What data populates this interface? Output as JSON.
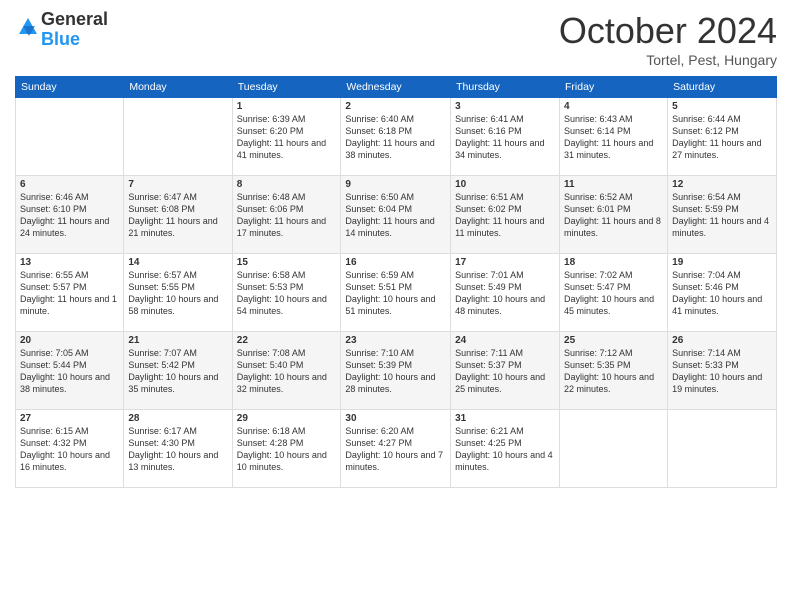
{
  "header": {
    "logo_general": "General",
    "logo_blue": "Blue",
    "month_title": "October 2024",
    "location": "Tortel, Pest, Hungary"
  },
  "weekdays": [
    "Sunday",
    "Monday",
    "Tuesday",
    "Wednesday",
    "Thursday",
    "Friday",
    "Saturday"
  ],
  "weeks": [
    [
      {
        "day": "",
        "sunrise": "",
        "sunset": "",
        "daylight": ""
      },
      {
        "day": "",
        "sunrise": "",
        "sunset": "",
        "daylight": ""
      },
      {
        "day": "1",
        "sunrise": "Sunrise: 6:39 AM",
        "sunset": "Sunset: 6:20 PM",
        "daylight": "Daylight: 11 hours and 41 minutes."
      },
      {
        "day": "2",
        "sunrise": "Sunrise: 6:40 AM",
        "sunset": "Sunset: 6:18 PM",
        "daylight": "Daylight: 11 hours and 38 minutes."
      },
      {
        "day": "3",
        "sunrise": "Sunrise: 6:41 AM",
        "sunset": "Sunset: 6:16 PM",
        "daylight": "Daylight: 11 hours and 34 minutes."
      },
      {
        "day": "4",
        "sunrise": "Sunrise: 6:43 AM",
        "sunset": "Sunset: 6:14 PM",
        "daylight": "Daylight: 11 hours and 31 minutes."
      },
      {
        "day": "5",
        "sunrise": "Sunrise: 6:44 AM",
        "sunset": "Sunset: 6:12 PM",
        "daylight": "Daylight: 11 hours and 27 minutes."
      }
    ],
    [
      {
        "day": "6",
        "sunrise": "Sunrise: 6:46 AM",
        "sunset": "Sunset: 6:10 PM",
        "daylight": "Daylight: 11 hours and 24 minutes."
      },
      {
        "day": "7",
        "sunrise": "Sunrise: 6:47 AM",
        "sunset": "Sunset: 6:08 PM",
        "daylight": "Daylight: 11 hours and 21 minutes."
      },
      {
        "day": "8",
        "sunrise": "Sunrise: 6:48 AM",
        "sunset": "Sunset: 6:06 PM",
        "daylight": "Daylight: 11 hours and 17 minutes."
      },
      {
        "day": "9",
        "sunrise": "Sunrise: 6:50 AM",
        "sunset": "Sunset: 6:04 PM",
        "daylight": "Daylight: 11 hours and 14 minutes."
      },
      {
        "day": "10",
        "sunrise": "Sunrise: 6:51 AM",
        "sunset": "Sunset: 6:02 PM",
        "daylight": "Daylight: 11 hours and 11 minutes."
      },
      {
        "day": "11",
        "sunrise": "Sunrise: 6:52 AM",
        "sunset": "Sunset: 6:01 PM",
        "daylight": "Daylight: 11 hours and 8 minutes."
      },
      {
        "day": "12",
        "sunrise": "Sunrise: 6:54 AM",
        "sunset": "Sunset: 5:59 PM",
        "daylight": "Daylight: 11 hours and 4 minutes."
      }
    ],
    [
      {
        "day": "13",
        "sunrise": "Sunrise: 6:55 AM",
        "sunset": "Sunset: 5:57 PM",
        "daylight": "Daylight: 11 hours and 1 minute."
      },
      {
        "day": "14",
        "sunrise": "Sunrise: 6:57 AM",
        "sunset": "Sunset: 5:55 PM",
        "daylight": "Daylight: 10 hours and 58 minutes."
      },
      {
        "day": "15",
        "sunrise": "Sunrise: 6:58 AM",
        "sunset": "Sunset: 5:53 PM",
        "daylight": "Daylight: 10 hours and 54 minutes."
      },
      {
        "day": "16",
        "sunrise": "Sunrise: 6:59 AM",
        "sunset": "Sunset: 5:51 PM",
        "daylight": "Daylight: 10 hours and 51 minutes."
      },
      {
        "day": "17",
        "sunrise": "Sunrise: 7:01 AM",
        "sunset": "Sunset: 5:49 PM",
        "daylight": "Daylight: 10 hours and 48 minutes."
      },
      {
        "day": "18",
        "sunrise": "Sunrise: 7:02 AM",
        "sunset": "Sunset: 5:47 PM",
        "daylight": "Daylight: 10 hours and 45 minutes."
      },
      {
        "day": "19",
        "sunrise": "Sunrise: 7:04 AM",
        "sunset": "Sunset: 5:46 PM",
        "daylight": "Daylight: 10 hours and 41 minutes."
      }
    ],
    [
      {
        "day": "20",
        "sunrise": "Sunrise: 7:05 AM",
        "sunset": "Sunset: 5:44 PM",
        "daylight": "Daylight: 10 hours and 38 minutes."
      },
      {
        "day": "21",
        "sunrise": "Sunrise: 7:07 AM",
        "sunset": "Sunset: 5:42 PM",
        "daylight": "Daylight: 10 hours and 35 minutes."
      },
      {
        "day": "22",
        "sunrise": "Sunrise: 7:08 AM",
        "sunset": "Sunset: 5:40 PM",
        "daylight": "Daylight: 10 hours and 32 minutes."
      },
      {
        "day": "23",
        "sunrise": "Sunrise: 7:10 AM",
        "sunset": "Sunset: 5:39 PM",
        "daylight": "Daylight: 10 hours and 28 minutes."
      },
      {
        "day": "24",
        "sunrise": "Sunrise: 7:11 AM",
        "sunset": "Sunset: 5:37 PM",
        "daylight": "Daylight: 10 hours and 25 minutes."
      },
      {
        "day": "25",
        "sunrise": "Sunrise: 7:12 AM",
        "sunset": "Sunset: 5:35 PM",
        "daylight": "Daylight: 10 hours and 22 minutes."
      },
      {
        "day": "26",
        "sunrise": "Sunrise: 7:14 AM",
        "sunset": "Sunset: 5:33 PM",
        "daylight": "Daylight: 10 hours and 19 minutes."
      }
    ],
    [
      {
        "day": "27",
        "sunrise": "Sunrise: 6:15 AM",
        "sunset": "Sunset: 4:32 PM",
        "daylight": "Daylight: 10 hours and 16 minutes."
      },
      {
        "day": "28",
        "sunrise": "Sunrise: 6:17 AM",
        "sunset": "Sunset: 4:30 PM",
        "daylight": "Daylight: 10 hours and 13 minutes."
      },
      {
        "day": "29",
        "sunrise": "Sunrise: 6:18 AM",
        "sunset": "Sunset: 4:28 PM",
        "daylight": "Daylight: 10 hours and 10 minutes."
      },
      {
        "day": "30",
        "sunrise": "Sunrise: 6:20 AM",
        "sunset": "Sunset: 4:27 PM",
        "daylight": "Daylight: 10 hours and 7 minutes."
      },
      {
        "day": "31",
        "sunrise": "Sunrise: 6:21 AM",
        "sunset": "Sunset: 4:25 PM",
        "daylight": "Daylight: 10 hours and 4 minutes."
      },
      {
        "day": "",
        "sunrise": "",
        "sunset": "",
        "daylight": ""
      },
      {
        "day": "",
        "sunrise": "",
        "sunset": "",
        "daylight": ""
      }
    ]
  ]
}
